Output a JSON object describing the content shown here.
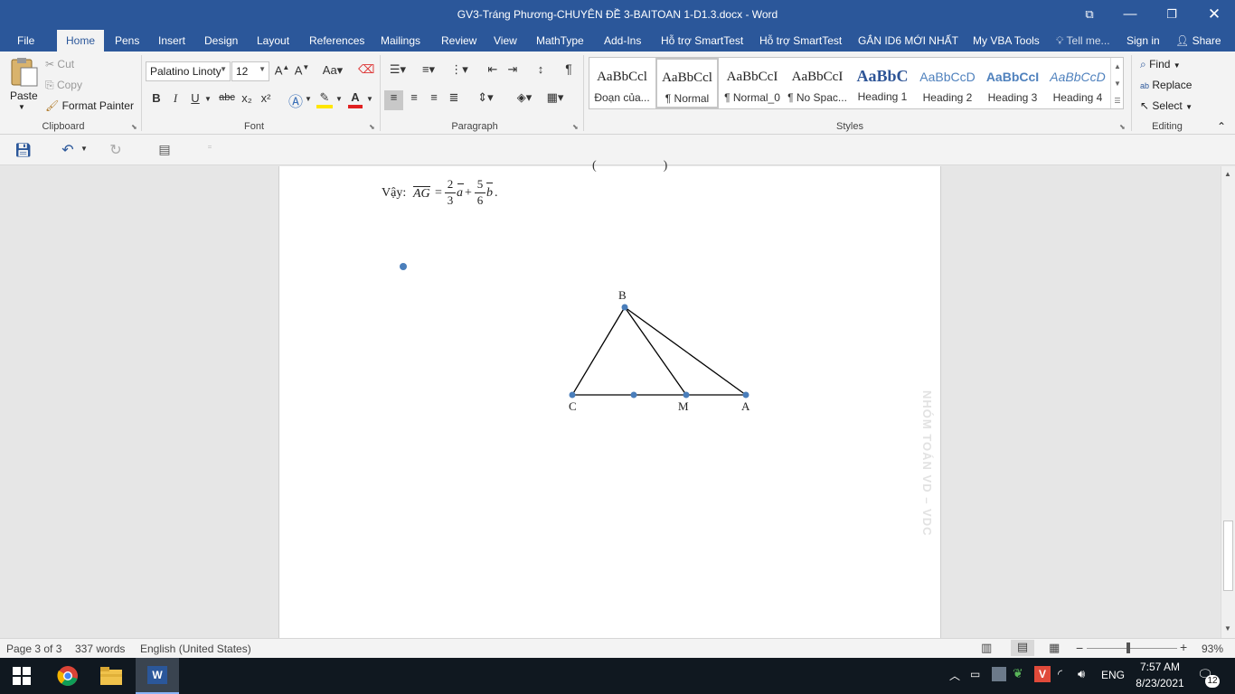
{
  "window": {
    "title": "GV3-Tráng Phương-CHUYÊN ĐỀ 3-BAITOAN 1-D1.3.docx - Word"
  },
  "tabs": [
    "File",
    "Home",
    "Pens",
    "Insert",
    "Design",
    "Layout",
    "References",
    "Mailings",
    "Review",
    "View",
    "MathType",
    "Add-Ins",
    "Hỗ trợ SmartTest",
    "Hỗ trợ SmartTest",
    "GẮN ID6 MỚI NHẤT",
    "My VBA Tools"
  ],
  "tell_me": "Tell me...",
  "sign_in": "Sign in",
  "share": "Share",
  "clipboard": {
    "paste": "Paste",
    "cut": "Cut",
    "copy": "Copy",
    "format_painter": "Format Painter",
    "label": "Clipboard"
  },
  "font": {
    "name": "Palatino Linoty",
    "size": "12",
    "label": "Font",
    "bold": "B",
    "italic": "I",
    "underline": "U",
    "strike": "abc",
    "sub": "x₂",
    "sup": "x²"
  },
  "paragraph": {
    "label": "Paragraph"
  },
  "styles": {
    "label": "Styles",
    "items": [
      {
        "preview": "AaBbCcl",
        "name": "Đoạn của..."
      },
      {
        "preview": "AaBbCcl",
        "name": "¶ Normal"
      },
      {
        "preview": "AaBbCcI",
        "name": "¶ Normal_0"
      },
      {
        "preview": "AaBbCcI",
        "name": "¶ No Spac..."
      },
      {
        "preview": "AaBbC",
        "name": "Heading 1"
      },
      {
        "preview": "AaBbCcD",
        "name": "Heading 2"
      },
      {
        "preview": "AaBbCcI",
        "name": "Heading 3"
      },
      {
        "preview": "AaBbCcD",
        "name": "Heading 4"
      }
    ]
  },
  "editing": {
    "find": "Find",
    "replace": "Replace",
    "select": "Select",
    "label": "Editing"
  },
  "document": {
    "conclusion_prefix": "Vậy:",
    "vector_ag": "AG",
    "eq": "=",
    "frac1_num": "2",
    "frac1_den": "3",
    "vec_a": "a",
    "plus": "+",
    "frac2_num": "5",
    "frac2_den": "6",
    "vec_b": "b",
    "dot": ".",
    "points": {
      "B": "B",
      "C": "C",
      "M": "M",
      "A": "A"
    },
    "watermark": "NHÓM TOÁN VD – VDC"
  },
  "status": {
    "page": "Page 3 of 3",
    "words": "337 words",
    "language": "English (United States)",
    "zoom": "93%",
    "zoom_level": 0.93
  },
  "taskbar": {
    "lang": "ENG",
    "time": "7:57 AM",
    "date": "8/23/2021",
    "notif": "12"
  },
  "colors": {
    "accent": "#2b579a",
    "taskbar": "#101820",
    "point": "#4a7ebb"
  }
}
